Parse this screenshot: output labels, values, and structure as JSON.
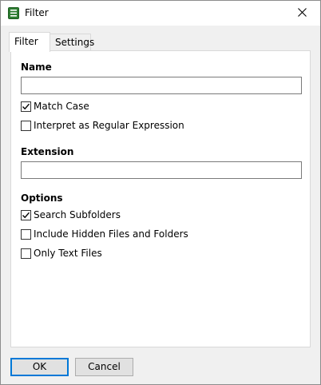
{
  "window": {
    "title": "Filter",
    "app_icon": "list-document-icon",
    "close_icon": "close-icon"
  },
  "tabs": [
    {
      "label": "Filter",
      "active": true
    },
    {
      "label": "Settings",
      "active": false
    }
  ],
  "name_section": {
    "label": "Name",
    "value": "",
    "checkboxes": [
      {
        "label": "Match Case",
        "checked": true
      },
      {
        "label": "Interpret as Regular Expression",
        "checked": false
      }
    ]
  },
  "extension_section": {
    "label": "Extension",
    "value": ""
  },
  "options_section": {
    "label": "Options",
    "checkboxes": [
      {
        "label": "Search Subfolders",
        "checked": true
      },
      {
        "label": "Include Hidden Files and Folders",
        "checked": false
      },
      {
        "label": "Only Text Files",
        "checked": false
      }
    ]
  },
  "buttons": {
    "ok": "OK",
    "cancel": "Cancel"
  },
  "colors": {
    "accent": "#0078d7",
    "icon_green": "#2e7d32"
  }
}
